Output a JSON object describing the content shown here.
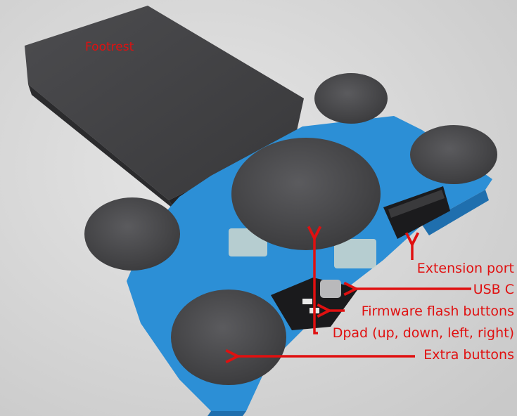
{
  "labels": {
    "footrest": "Footrest",
    "extension_port": "Extension port",
    "usb_c": "USB C",
    "firmware_flash": "Firmware flash buttons",
    "dpad": "Dpad (up, down, left, right)",
    "extra_buttons": "Extra buttons"
  },
  "colors": {
    "annotation": "#e01010",
    "base_blue": "#2c8fd6",
    "pad_gray": "#4a4a4d",
    "background": "#dcdcdc"
  }
}
